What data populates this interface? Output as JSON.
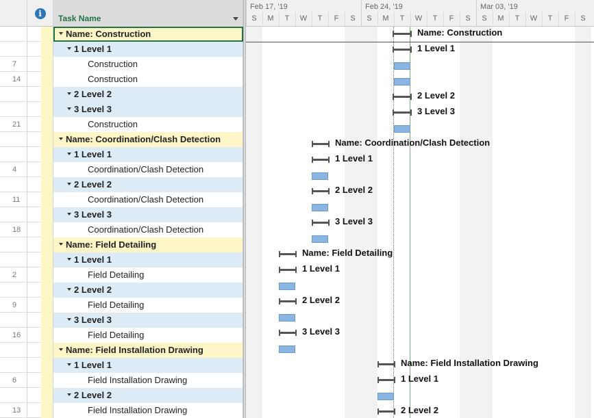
{
  "grid": {
    "column_task_name": "Task Name",
    "info_icon_glyph": "i",
    "rows": [
      {
        "id": "",
        "name": "Name: Construction",
        "kind": "summary",
        "selected": true
      },
      {
        "id": "",
        "name": "1  Level 1",
        "kind": "sub"
      },
      {
        "id": "7",
        "name": "Construction",
        "kind": "task"
      },
      {
        "id": "14",
        "name": "Construction",
        "kind": "task"
      },
      {
        "id": "",
        "name": "2  Level 2",
        "kind": "sub"
      },
      {
        "id": "",
        "name": "3  Level 3",
        "kind": "sub"
      },
      {
        "id": "21",
        "name": "Construction",
        "kind": "task"
      },
      {
        "id": "",
        "name": "Name: Coordination/Clash Detection",
        "kind": "summary"
      },
      {
        "id": "",
        "name": "1  Level 1",
        "kind": "sub"
      },
      {
        "id": "4",
        "name": "Coordination/Clash Detection",
        "kind": "task"
      },
      {
        "id": "",
        "name": "2  Level 2",
        "kind": "sub"
      },
      {
        "id": "11",
        "name": "Coordination/Clash Detection",
        "kind": "task"
      },
      {
        "id": "",
        "name": "3  Level 3",
        "kind": "sub"
      },
      {
        "id": "18",
        "name": "Coordination/Clash Detection",
        "kind": "task"
      },
      {
        "id": "",
        "name": "Name: Field Detailing",
        "kind": "summary"
      },
      {
        "id": "",
        "name": "1  Level 1",
        "kind": "sub"
      },
      {
        "id": "2",
        "name": "Field Detailing",
        "kind": "task"
      },
      {
        "id": "",
        "name": "2  Level 2",
        "kind": "sub"
      },
      {
        "id": "9",
        "name": "Field Detailing",
        "kind": "task"
      },
      {
        "id": "",
        "name": "3  Level 3",
        "kind": "sub"
      },
      {
        "id": "16",
        "name": "Field Detailing",
        "kind": "task"
      },
      {
        "id": "",
        "name": "Name: Field Installation Drawing",
        "kind": "summary"
      },
      {
        "id": "",
        "name": "1  Level 1",
        "kind": "sub"
      },
      {
        "id": "6",
        "name": "Field Installation Drawing",
        "kind": "task"
      },
      {
        "id": "",
        "name": "2  Level 2",
        "kind": "sub"
      },
      {
        "id": "13",
        "name": "Field Installation Drawing",
        "kind": "task"
      }
    ]
  },
  "timeline": {
    "weeks": [
      "Feb 17, '19",
      "Feb 24, '19",
      "Mar 03, '19"
    ],
    "days": [
      "S",
      "M",
      "T",
      "W",
      "T",
      "F",
      "S",
      "S",
      "M",
      "T",
      "W",
      "T",
      "F",
      "S",
      "S",
      "M",
      "T",
      "W",
      "T",
      "F",
      "S"
    ],
    "colors": {
      "task_bar": "#8ab4e2",
      "summary_bar": "#555555",
      "status_line": "#6db06d"
    }
  }
}
